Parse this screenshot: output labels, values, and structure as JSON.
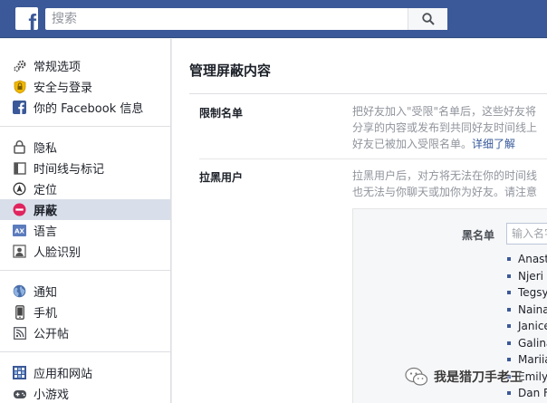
{
  "header": {
    "logo_letter": "f",
    "search_placeholder": "搜索"
  },
  "sidebar": {
    "groups": [
      {
        "items": [
          {
            "label": "常规选项",
            "icon": "gears-icon"
          },
          {
            "label": "安全与登录",
            "icon": "shield-icon"
          },
          {
            "label": "你的 Facebook 信息",
            "icon": "facebook-icon"
          }
        ]
      },
      {
        "items": [
          {
            "label": "隐私",
            "icon": "lock-icon"
          },
          {
            "label": "时间线与标记",
            "icon": "timeline-icon"
          },
          {
            "label": "定位",
            "icon": "location-icon"
          },
          {
            "label": "屏蔽",
            "icon": "block-icon",
            "active": true
          },
          {
            "label": "语言",
            "icon": "language-icon"
          },
          {
            "label": "人脸识别",
            "icon": "face-icon"
          }
        ]
      },
      {
        "items": [
          {
            "label": "通知",
            "icon": "globe-icon"
          },
          {
            "label": "手机",
            "icon": "phone-icon"
          },
          {
            "label": "公开帖",
            "icon": "rss-icon"
          }
        ]
      },
      {
        "items": [
          {
            "label": "应用和网站",
            "icon": "apps-icon"
          },
          {
            "label": "小游戏",
            "icon": "games-icon"
          }
        ]
      }
    ]
  },
  "main": {
    "title": "管理屏蔽内容",
    "restricted": {
      "label": "限制名单",
      "lines": [
        "把好友加入\"受限\"名单后，这些好友将",
        "分享的内容或发布到共同好友时间线上",
        "好友已被加入受限名单。"
      ],
      "link": "详细了解"
    },
    "block_users": {
      "label": "拉黑用户",
      "lines": [
        "拉黑用户后，对方将无法在你的时间线",
        "也无法与你聊天或加你为好友。请注意"
      ]
    },
    "blacklist": {
      "label": "黑名单",
      "input_placeholder": "输入名字",
      "names": [
        "Anast",
        "Njeri W",
        "Tegsy",
        "Naina",
        "Janice",
        "Galina",
        "Mariia",
        "Emily",
        "Dan F"
      ]
    }
  },
  "watermark": {
    "text": "我是猎刀手老王"
  },
  "colors": {
    "brand": "#3b5998",
    "active_bg": "#d8dfea",
    "link": "#365899"
  }
}
